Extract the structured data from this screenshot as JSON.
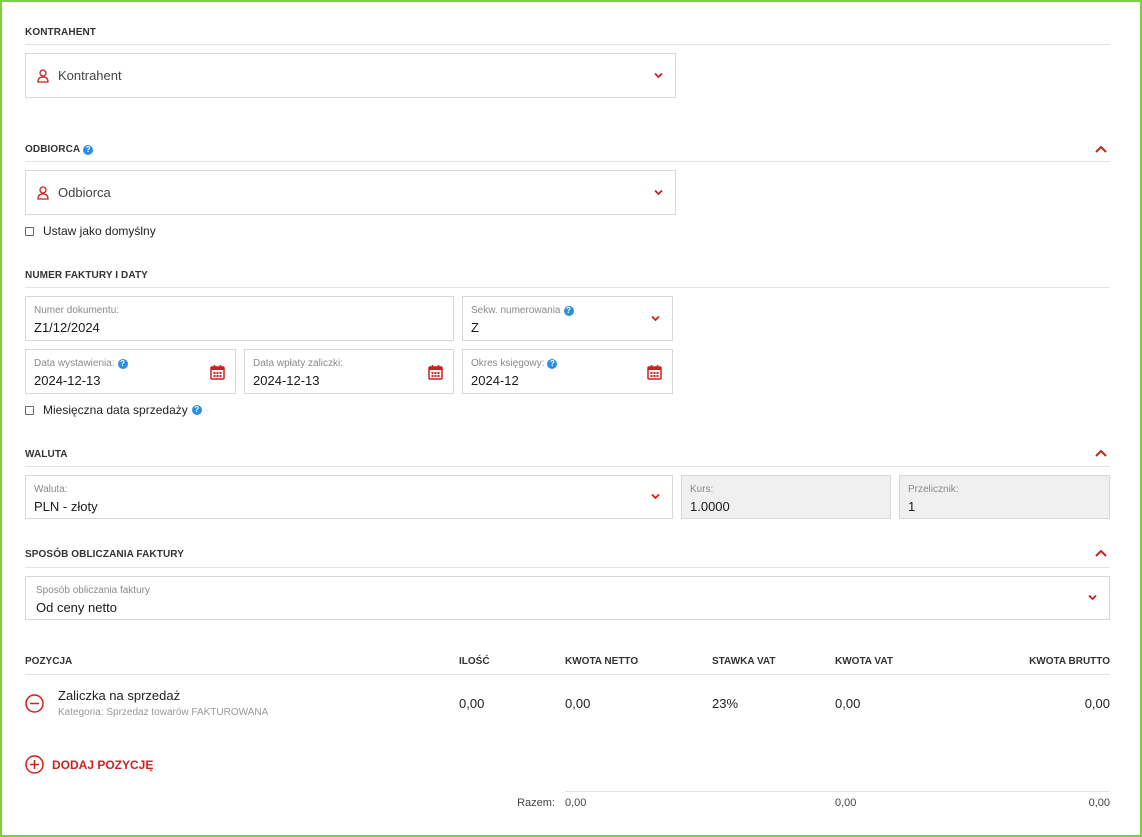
{
  "colors": {
    "accent": "#d01f1f",
    "help": "#2b8ee6",
    "frame": "#7ad13c"
  },
  "kontrahent": {
    "section_title": "KONTRAHENT",
    "placeholder": "Kontrahent",
    "icon": "person-icon"
  },
  "odbiorca": {
    "section_title": "ODBIORCA",
    "placeholder": "Odbiorca",
    "help": "?",
    "default_checkbox_label": "Ustaw jako domyślny",
    "default_checked": false
  },
  "numer": {
    "section_title": "NUMER FAKTURY I DATY",
    "doc_number_label": "Numer dokumentu:",
    "doc_number_value": "Z1/12/2024",
    "seq_label": "Sekw. numerowania",
    "seq_value": "Z",
    "issue_date_label": "Data wystawienia:",
    "issue_date_value": "2024-12-13",
    "payment_date_label": "Data wpłaty zaliczki:",
    "payment_date_value": "2024-12-13",
    "period_label": "Okres księgowy:",
    "period_value": "2024-12",
    "monthly_checkbox_label": "Miesięczna data sprzedaży",
    "monthly_checked": false
  },
  "waluta": {
    "section_title": "WALUTA",
    "currency_label": "Waluta:",
    "currency_value": "PLN - złoty",
    "rate_label": "Kurs:",
    "rate_value": "1.0000",
    "converter_label": "Przelicznik:",
    "converter_value": "1"
  },
  "sposob": {
    "section_title": "SPOSÓB OBLICZANIA FAKTURY",
    "method_label": "Sposób obliczania faktury",
    "method_value": "Od ceny netto"
  },
  "table": {
    "headers": {
      "position": "POZYCJA",
      "qty": "ILOŚĆ",
      "net": "KWOTA NETTO",
      "vat_rate": "STAWKA VAT",
      "vat": "KWOTA VAT",
      "gross": "KWOTA BRUTTO"
    },
    "rows": [
      {
        "name": "Zaliczka na sprzedaż",
        "category": "Kategoria: Sprzedaz towarów FAKTUROWANA",
        "qty": "0,00",
        "net": "0,00",
        "vat_rate": "23%",
        "vat": "0,00",
        "gross": "0,00"
      }
    ],
    "add_label": "DODAJ POZYCJĘ",
    "totals": {
      "label": "Razem:",
      "net": "0,00",
      "vat": "0,00",
      "gross": "0,00"
    }
  }
}
